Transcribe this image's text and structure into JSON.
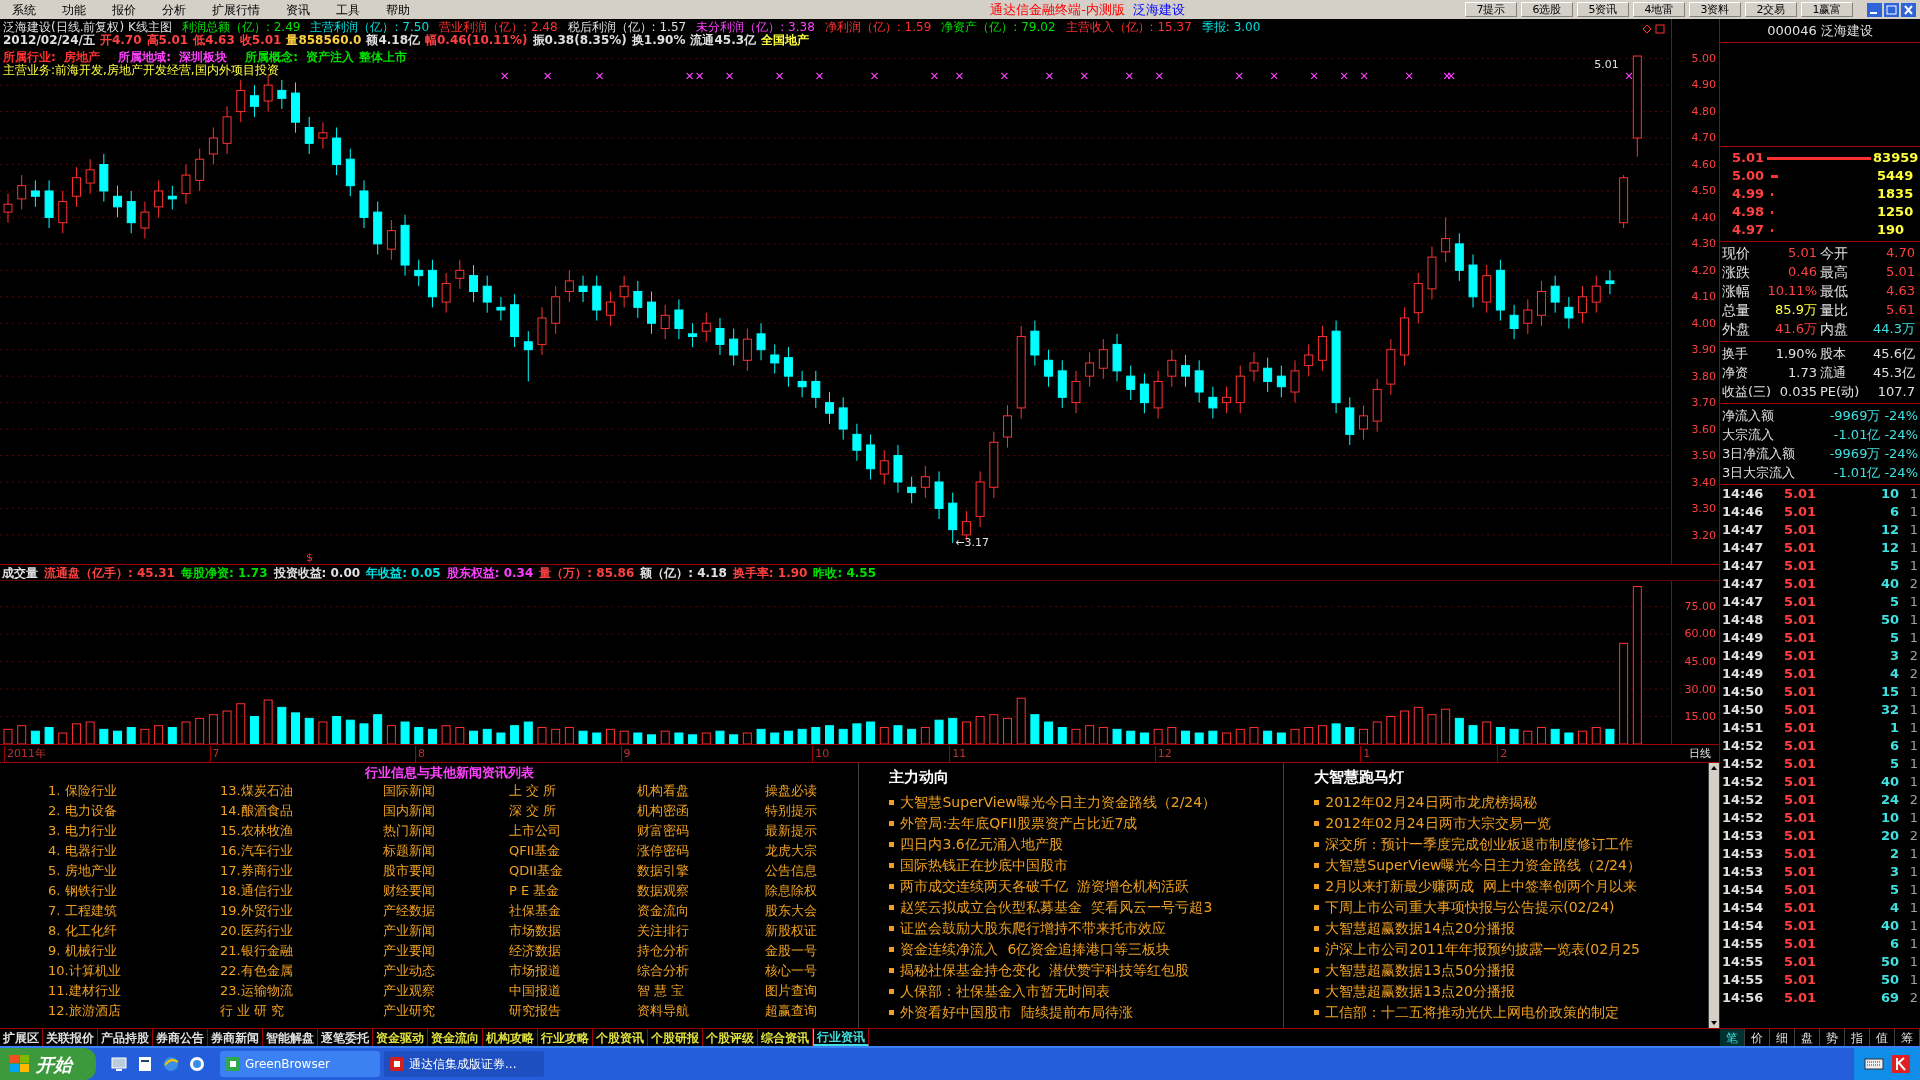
{
  "menu": [
    "系统",
    "功能",
    "报价",
    "分析",
    "扩展行情",
    "资讯",
    "工具",
    "帮助"
  ],
  "title_bar": {
    "app_title": "通达信金融终端-内测版",
    "stock_name": "泛海建设",
    "buttons": [
      "7提示",
      "6选股",
      "5资讯",
      "4地雷",
      "3资料",
      "2交易",
      "1赢富"
    ]
  },
  "chart": {
    "header_title": "泛海建设(日线.前复权) K线主图",
    "finance": [
      {
        "text": "利润总额（亿）: 2.49",
        "color": "#00e000"
      },
      {
        "text": "主营利润（亿）: 7.50",
        "color": "#00e0e0"
      },
      {
        "text": "营业利润（亿）: 2.48",
        "color": "#ff3030"
      },
      {
        "text": "税后利润（亿）: 1.57",
        "color": "#e0e0e0"
      },
      {
        "text": "未分利润（亿）: 3.38",
        "color": "#ff40ff"
      },
      {
        "text": "净利润（亿）: 1.59",
        "color": "#ff3030"
      },
      {
        "text": "净资产（亿）: 79.02",
        "color": "#00e000"
      },
      {
        "text": "主营收入（亿）: 15.37",
        "color": "#ff3030"
      },
      {
        "text": "季报: 3.00",
        "color": "#00e0e0"
      }
    ],
    "quote_line": [
      {
        "text": "2012/02/24/五",
        "color": "#e0e0e0"
      },
      {
        "text": "开4.70",
        "color": "#ff4040"
      },
      {
        "text": "高5.01",
        "color": "#ff4040"
      },
      {
        "text": "低4.63",
        "color": "#ff4040"
      },
      {
        "text": "收5.01",
        "color": "#ff4040"
      },
      {
        "text": "量858560.0",
        "color": "#ffd040"
      },
      {
        "text": "额4.18亿",
        "color": "#e0e0e0"
      },
      {
        "text": "幅0.46(10.11%)",
        "color": "#ff4040"
      },
      {
        "text": "振0.38(8.35%)",
        "color": "#e0e0e0"
      },
      {
        "text": "换1.90%",
        "color": "#e0e0e0"
      },
      {
        "text": "流通45.3亿",
        "color": "#e0e0e0"
      },
      {
        "text": "全国地产",
        "color": "#ffff40"
      }
    ],
    "tags": [
      {
        "label": "所属行业:",
        "value": "房地产",
        "color": "#ff3030"
      },
      {
        "label": "所属地域:",
        "value": "深圳板块",
        "color": "#ff40ff"
      },
      {
        "label": "所属概念:",
        "value": "资产注入 整体上市",
        "color": "#00e000"
      }
    ],
    "business": "主营业务:前海开发,房地产开发经营,国内外项目投资",
    "high_label": "5.01",
    "low_label": "←3.17",
    "chart_data": {
      "type": "candlestick",
      "grid": true,
      "ylim": [
        3.09,
        5.15
      ],
      "yticks": [
        {
          "value": 5,
          "label": "5.00"
        },
        {
          "value": 4.9,
          "label": "4.90"
        },
        {
          "value": 4.8,
          "label": "4.80"
        },
        {
          "value": 4.7,
          "label": "4.70"
        },
        {
          "value": 4.6,
          "label": "4.60"
        },
        {
          "value": 4.5,
          "label": "4.50"
        },
        {
          "value": 4.4,
          "label": "4.40"
        },
        {
          "value": 4.3,
          "label": "4.30"
        },
        {
          "value": 4.2,
          "label": "4.20"
        },
        {
          "value": 4.1,
          "label": "4.10"
        },
        {
          "value": 4,
          "label": "4.00"
        },
        {
          "value": 3.9,
          "label": "3.90"
        },
        {
          "value": 3.8,
          "label": "3.80"
        },
        {
          "value": 3.7,
          "label": "3.70"
        },
        {
          "value": 3.6,
          "label": "3.60"
        },
        {
          "value": 3.5,
          "label": "3.50"
        },
        {
          "value": 3.4,
          "label": "3.40"
        },
        {
          "value": 3.3,
          "label": "3.30"
        },
        {
          "value": 3.2,
          "label": "3.20"
        }
      ],
      "ohlc": [
        [
          4.42,
          4.49,
          4.38,
          4.45
        ],
        [
          4.47,
          4.56,
          4.43,
          4.52
        ],
        [
          4.5,
          4.54,
          4.44,
          4.48
        ],
        [
          4.5,
          4.54,
          4.36,
          4.4
        ],
        [
          4.38,
          4.5,
          4.34,
          4.46
        ],
        [
          4.48,
          4.59,
          4.44,
          4.55
        ],
        [
          4.53,
          4.62,
          4.49,
          4.58
        ],
        [
          4.6,
          4.64,
          4.46,
          4.5
        ],
        [
          4.48,
          4.52,
          4.4,
          4.44
        ],
        [
          4.46,
          4.5,
          4.34,
          4.38
        ],
        [
          4.36,
          4.46,
          4.32,
          4.42
        ],
        [
          4.44,
          4.54,
          4.4,
          4.5
        ],
        [
          4.48,
          4.52,
          4.43,
          4.47
        ],
        [
          4.49,
          4.6,
          4.45,
          4.56
        ],
        [
          4.54,
          4.66,
          4.5,
          4.62
        ],
        [
          4.64,
          4.74,
          4.6,
          4.7
        ],
        [
          4.68,
          4.82,
          4.64,
          4.78
        ],
        [
          4.8,
          4.92,
          4.76,
          4.88
        ],
        [
          4.86,
          4.9,
          4.78,
          4.82
        ],
        [
          4.84,
          4.94,
          4.8,
          4.9
        ],
        [
          4.88,
          4.92,
          4.81,
          4.85
        ],
        [
          4.87,
          4.91,
          4.72,
          4.76
        ],
        [
          4.74,
          4.78,
          4.64,
          4.68
        ],
        [
          4.7,
          4.76,
          4.66,
          4.72
        ],
        [
          4.7,
          4.74,
          4.56,
          4.6
        ],
        [
          4.62,
          4.66,
          4.48,
          4.52
        ],
        [
          4.5,
          4.54,
          4.36,
          4.4
        ],
        [
          4.42,
          4.46,
          4.26,
          4.3
        ],
        [
          4.28,
          4.39,
          4.24,
          4.35
        ],
        [
          4.37,
          4.41,
          4.18,
          4.22
        ],
        [
          4.2,
          4.24,
          4.14,
          4.18
        ],
        [
          4.2,
          4.24,
          4.06,
          4.1
        ],
        [
          4.08,
          4.19,
          4.04,
          4.15
        ],
        [
          4.17,
          4.24,
          4.13,
          4.2
        ],
        [
          4.18,
          4.22,
          4.08,
          4.12
        ],
        [
          4.14,
          4.18,
          4.04,
          4.08
        ],
        [
          4.06,
          4.1,
          4.01,
          4.05
        ],
        [
          4.07,
          4.11,
          3.91,
          3.95
        ],
        [
          3.93,
          3.97,
          3.78,
          3.9
        ],
        [
          3.92,
          4.06,
          3.88,
          4.02
        ],
        [
          4.0,
          4.14,
          3.96,
          4.1
        ],
        [
          4.12,
          4.2,
          4.08,
          4.16
        ],
        [
          4.14,
          4.18,
          4.08,
          4.12
        ],
        [
          4.14,
          4.18,
          4.01,
          4.05
        ],
        [
          4.03,
          4.12,
          3.99,
          4.08
        ],
        [
          4.1,
          4.18,
          4.06,
          4.14
        ],
        [
          4.12,
          4.16,
          4.02,
          4.06
        ],
        [
          4.08,
          4.12,
          3.96,
          4.0
        ],
        [
          3.98,
          4.07,
          3.94,
          4.03
        ],
        [
          4.05,
          4.09,
          3.94,
          3.98
        ],
        [
          3.96,
          4.0,
          3.91,
          3.95
        ],
        [
          3.97,
          4.04,
          3.93,
          4.0
        ],
        [
          3.98,
          4.02,
          3.88,
          3.92
        ],
        [
          3.94,
          3.98,
          3.84,
          3.88
        ],
        [
          3.86,
          3.98,
          3.82,
          3.94
        ],
        [
          3.96,
          4.0,
          3.86,
          3.9
        ],
        [
          3.88,
          3.92,
          3.81,
          3.85
        ],
        [
          3.87,
          3.91,
          3.76,
          3.8
        ],
        [
          3.78,
          3.82,
          3.72,
          3.76
        ],
        [
          3.78,
          3.82,
          3.68,
          3.72
        ],
        [
          3.7,
          3.74,
          3.62,
          3.66
        ],
        [
          3.68,
          3.72,
          3.56,
          3.6
        ],
        [
          3.58,
          3.62,
          3.48,
          3.52
        ],
        [
          3.54,
          3.58,
          3.41,
          3.45
        ],
        [
          3.43,
          3.52,
          3.39,
          3.48
        ],
        [
          3.5,
          3.54,
          3.36,
          3.4
        ],
        [
          3.38,
          3.42,
          3.32,
          3.36
        ],
        [
          3.38,
          3.46,
          3.34,
          3.42
        ],
        [
          3.4,
          3.44,
          3.26,
          3.3
        ],
        [
          3.32,
          3.36,
          3.17,
          3.22
        ],
        [
          3.2,
          3.29,
          3.18,
          3.25
        ],
        [
          3.27,
          3.44,
          3.23,
          3.4
        ],
        [
          3.38,
          3.59,
          3.34,
          3.55
        ],
        [
          3.57,
          3.69,
          3.53,
          3.65
        ],
        [
          3.68,
          3.99,
          3.64,
          3.95
        ],
        [
          3.97,
          4.01,
          3.84,
          3.88
        ],
        [
          3.86,
          3.9,
          3.76,
          3.8
        ],
        [
          3.82,
          3.86,
          3.68,
          3.72
        ],
        [
          3.7,
          3.82,
          3.66,
          3.78
        ],
        [
          3.8,
          3.89,
          3.76,
          3.85
        ],
        [
          3.83,
          3.94,
          3.79,
          3.9
        ],
        [
          3.92,
          3.96,
          3.78,
          3.82
        ],
        [
          3.8,
          3.84,
          3.71,
          3.75
        ],
        [
          3.77,
          3.81,
          3.66,
          3.7
        ],
        [
          3.68,
          3.82,
          3.64,
          3.78
        ],
        [
          3.8,
          3.9,
          3.76,
          3.86
        ],
        [
          3.84,
          3.88,
          3.76,
          3.8
        ],
        [
          3.82,
          3.86,
          3.7,
          3.74
        ],
        [
          3.72,
          3.76,
          3.64,
          3.68
        ],
        [
          3.7,
          3.76,
          3.66,
          3.72
        ],
        [
          3.7,
          3.84,
          3.66,
          3.8
        ],
        [
          3.82,
          3.89,
          3.78,
          3.85
        ],
        [
          3.83,
          3.87,
          3.74,
          3.78
        ],
        [
          3.8,
          3.84,
          3.72,
          3.76
        ],
        [
          3.74,
          3.86,
          3.7,
          3.82
        ],
        [
          3.84,
          3.92,
          3.8,
          3.88
        ],
        [
          3.86,
          3.99,
          3.82,
          3.95
        ],
        [
          3.97,
          4.01,
          3.66,
          3.7
        ],
        [
          3.68,
          3.72,
          3.54,
          3.58
        ],
        [
          3.6,
          3.69,
          3.56,
          3.65
        ],
        [
          3.63,
          3.79,
          3.59,
          3.75
        ],
        [
          3.77,
          3.94,
          3.73,
          3.9
        ],
        [
          3.88,
          4.06,
          3.84,
          4.02
        ],
        [
          4.04,
          4.19,
          4.0,
          4.15
        ],
        [
          4.13,
          4.29,
          4.09,
          4.25
        ],
        [
          4.27,
          4.4,
          4.23,
          4.32
        ],
        [
          4.3,
          4.34,
          4.16,
          4.2
        ],
        [
          4.22,
          4.26,
          4.06,
          4.1
        ],
        [
          4.08,
          4.22,
          4.04,
          4.18
        ],
        [
          4.2,
          4.24,
          4.01,
          4.05
        ],
        [
          4.03,
          4.07,
          3.94,
          3.98
        ],
        [
          4.0,
          4.09,
          3.96,
          4.05
        ],
        [
          4.03,
          4.16,
          3.99,
          4.12
        ],
        [
          4.14,
          4.18,
          4.04,
          4.08
        ],
        [
          4.06,
          4.1,
          3.98,
          4.02
        ],
        [
          4.04,
          4.14,
          4.0,
          4.1
        ],
        [
          4.08,
          4.18,
          4.04,
          4.14
        ],
        [
          4.16,
          4.2,
          4.11,
          4.15
        ],
        [
          4.38,
          4.56,
          4.36,
          4.55
        ],
        [
          4.7,
          5.01,
          4.63,
          5.01
        ]
      ]
    }
  },
  "volume": {
    "header": [
      {
        "text": "成交量",
        "color": "#e0e0e0"
      },
      {
        "text": "流通盘（亿手）: 45.31",
        "color": "#ff4040"
      },
      {
        "text": "每股净资: 1.73",
        "color": "#00e000"
      },
      {
        "text": "投资收益: 0.00",
        "color": "#e0e0e0"
      },
      {
        "text": "年收益: 0.05",
        "color": "#00e0e0"
      },
      {
        "text": "股东权益: 0.34",
        "color": "#ff40ff"
      },
      {
        "text": "量（万）: 85.86",
        "color": "#ff4040"
      },
      {
        "text": "额（亿）: 4.18",
        "color": "#e0e0e0"
      },
      {
        "text": "换手率: 1.90",
        "color": "#ff4040"
      },
      {
        "text": "昨收: 4.55",
        "color": "#00e000"
      }
    ],
    "marker": "$",
    "chart_data": {
      "type": "bar",
      "grid": true,
      "ylim": [
        0,
        89
      ],
      "yticks": [
        {
          "value": 75,
          "label": "75.00"
        },
        {
          "value": 60,
          "label": "60.00"
        },
        {
          "value": 45,
          "label": "45.00"
        },
        {
          "value": 30,
          "label": "30.00"
        },
        {
          "value": 15,
          "label": "15.00"
        }
      ],
      "values": [
        8,
        10,
        7,
        9,
        6,
        11,
        12,
        8,
        7,
        9,
        8,
        10,
        9,
        12,
        14,
        16,
        18,
        22,
        15,
        24,
        20,
        17,
        14,
        12,
        15,
        13,
        11,
        16,
        10,
        12,
        9,
        8,
        10,
        9,
        7,
        8,
        6,
        10,
        12,
        9,
        8,
        9,
        7,
        6,
        8,
        7,
        6,
        5,
        7,
        6,
        5,
        6,
        7,
        5,
        6,
        8,
        6,
        7,
        8,
        9,
        10,
        8,
        11,
        12,
        9,
        10,
        8,
        9,
        13,
        14,
        12,
        15,
        16,
        14,
        25,
        16,
        12,
        9,
        8,
        10,
        9,
        8,
        7,
        6,
        8,
        9,
        7,
        6,
        7,
        6,
        8,
        9,
        7,
        6,
        8,
        9,
        10,
        11,
        9,
        8,
        12,
        15,
        18,
        20,
        16,
        19,
        14,
        10,
        12,
        9,
        8,
        7,
        9,
        8,
        6,
        7,
        9,
        8,
        55,
        86
      ]
    }
  },
  "time_axis": {
    "labels": [
      "2011年",
      "7",
      "8",
      "9",
      "10",
      "11",
      "12",
      "1",
      "2"
    ],
    "period": "日线"
  },
  "industry_list": {
    "title": "行业信息与其他新闻资讯列表",
    "columns": [
      [
        "1. 保险行业",
        "2. 电力设备",
        "3. 电力行业",
        "4. 电器行业",
        "5. 房地产业",
        "6. 钢铁行业",
        "7. 工程建筑",
        "8. 化工化纤",
        "9. 机械行业",
        "10.计算机业",
        "11.建材行业",
        "12.旅游酒店"
      ],
      [
        "13.煤炭石油",
        "14.酿酒食品",
        "15.农林牧渔",
        "16.汽车行业",
        "17.券商行业",
        "18.通信行业",
        "19.外贸行业",
        "20.医药行业",
        "21.银行金融",
        "22.有色金属",
        "23.运输物流",
        "行 业 研 究"
      ],
      [
        "国际新闻",
        "国内新闻",
        "热门新闻",
        "标题新闻",
        "股市要闻",
        "财经要闻",
        "产经数据",
        "产业新闻",
        "产业要闻",
        "产业动态",
        "产业观察",
        "产业研究"
      ],
      [
        "上 交 所",
        "深 交 所",
        "上市公司",
        "QFII基金",
        "QDII基金",
        "P E 基金",
        "社保基金",
        "市场数据",
        "经济数据",
        "市场报道",
        "中国报道",
        "研究报告"
      ],
      [
        "机构看盘",
        "机构密函",
        "财富密码",
        "涨停密码",
        "数据引擎",
        "数据观察",
        "资金流向",
        "关注排行",
        "持仓分析",
        "综合分析",
        "智 慧 宝",
        "资料导航"
      ],
      [
        "操盘必读",
        "特别提示",
        "最新提示",
        "龙虎大宗",
        "公告信息",
        "除息除权",
        "股东大会",
        "新股权证",
        "金股一号",
        "核心一号",
        "图片查询",
        "超赢查询"
      ]
    ]
  },
  "news": [
    {
      "title": "主力动向",
      "items": [
        "大智慧SuperView曝光今日主力资金路线（2/24）",
        "外管局:去年底QFII股票资产占比近7成",
        "四日内3.6亿元涌入地产股",
        "国际热钱正在抄底中国股市",
        "两市成交连续两天各破千亿  游资增仓机构活跃",
        "赵笑云拟成立合伙型私募基金  笑看风云一号亏超3",
        "证监会鼓励大股东爬行增持不带来托市效应",
        "资金连续净流入  6亿资金追捧港口等三板块",
        "揭秘社保基金持仓变化  潜伏赞宇科技等红包股",
        "人保部：社保基金入市暂无时间表",
        "外资看好中国股市  陆续提前布局待涨"
      ]
    },
    {
      "title": "大智慧跑马灯",
      "items": [
        "2012年02月24日两市龙虎榜揭秘",
        "2012年02月24日两市大宗交易一览",
        "深交所：预计一季度完成创业板退市制度修订工作",
        "大智慧SuperView曝光今日主力资金路线（2/24）",
        "2月以来打新最少赚两成  网上中签率创两个月以来",
        "下周上市公司重大事项快报与公告提示(02/24)",
        "大智慧超赢数据14点20分播报",
        "沪深上市公司2011年年报预约披露一览表(02月25",
        "大智慧超赢数据13点50分播报",
        "大智慧超赢数据13点20分播报",
        "工信部：十二五将推动光伏上网电价政策的制定"
      ]
    }
  ],
  "bottom_tabs": [
    {
      "label": "扩展区",
      "selected": false,
      "color": "#e0e0e0"
    },
    {
      "label": "关联报价",
      "selected": false,
      "color": "#e0e0e0"
    },
    {
      "label": "产品持股",
      "selected": false,
      "color": "#e0e0e0"
    },
    {
      "label": "券商公告",
      "selected": false,
      "color": "#e0e0e0"
    },
    {
      "label": "券商新闻",
      "selected": false,
      "color": "#e0e0e0"
    },
    {
      "label": "智能解盘",
      "selected": false,
      "color": "#e0e0e0"
    },
    {
      "label": "逐笔委托",
      "selected": false,
      "color": "#e0e0e0"
    },
    {
      "label": "资金驱动",
      "selected": false,
      "color": "#e0e040"
    },
    {
      "label": "资金流向",
      "selected": false,
      "color": "#e0e040"
    },
    {
      "label": "机构攻略",
      "selected": false,
      "color": "#e0e040"
    },
    {
      "label": "行业攻略",
      "selected": false,
      "color": "#e0e040"
    },
    {
      "label": "个股资讯",
      "selected": false,
      "color": "#e0e040"
    },
    {
      "label": "个股研报",
      "selected": false,
      "color": "#e0e040"
    },
    {
      "label": "个股评级",
      "selected": false,
      "color": "#e0e040"
    },
    {
      "label": "综合资讯",
      "selected": false,
      "color": "#e0e040"
    },
    {
      "label": "行业资讯",
      "selected": true,
      "color": "#40e0e0"
    }
  ],
  "side": {
    "code": "000046",
    "name": "泛海建设",
    "order_book": [
      {
        "price": "5.01",
        "volume": "83959"
      },
      {
        "price": "5.00",
        "volume": "5449"
      },
      {
        "price": "4.99",
        "volume": "1835"
      },
      {
        "price": "4.98",
        "volume": "1250"
      },
      {
        "price": "4.97",
        "volume": "190"
      }
    ],
    "quote": [
      [
        {
          "label": "现价",
          "value": "5.01",
          "color": "#ff4040"
        },
        {
          "label": "今开",
          "value": "4.70",
          "color": "#ff4040"
        }
      ],
      [
        {
          "label": "涨跌",
          "value": "0.46",
          "color": "#ff4040"
        },
        {
          "label": "最高",
          "value": "5.01",
          "color": "#ff4040"
        }
      ],
      [
        {
          "label": "涨幅",
          "value": "10.11%",
          "color": "#ff4040"
        },
        {
          "label": "最低",
          "value": "4.63",
          "color": "#ff4040"
        }
      ],
      [
        {
          "label": "总量",
          "value": "85.9万",
          "color": "#ffff40"
        },
        {
          "label": "量比",
          "value": "5.61",
          "color": "#ff4040"
        }
      ],
      [
        {
          "label": "外盘",
          "value": "41.6万",
          "color": "#ff4040"
        },
        {
          "label": "内盘",
          "value": "44.3万",
          "color": "#40e0e0"
        }
      ]
    ],
    "fundamentals": [
      [
        {
          "label": "换手",
          "value": "1.90%"
        },
        {
          "label": "股本",
          "value": "45.6亿"
        }
      ],
      [
        {
          "label": "净资",
          "value": "1.73"
        },
        {
          "label": "流通",
          "value": "45.3亿"
        }
      ],
      [
        {
          "label": "收益(三)",
          "value": "0.035"
        },
        {
          "label": "PE(动)",
          "value": "107.7"
        }
      ]
    ],
    "fund_flow": [
      {
        "label": "净流入额",
        "value": "-9969万",
        "pct": "-24%"
      },
      {
        "label": "大宗流入",
        "value": "-1.01亿",
        "pct": "-24%"
      },
      {
        "label": "3日净流入额",
        "value": "-9969万",
        "pct": "-24%"
      },
      {
        "label": "3日大宗流入",
        "value": "-1.01亿",
        "pct": "-24%"
      }
    ],
    "ticks": [
      [
        "14:46",
        "5.01",
        "10",
        "1"
      ],
      [
        "14:46",
        "5.01",
        "6",
        "1"
      ],
      [
        "14:47",
        "5.01",
        "12",
        "1"
      ],
      [
        "14:47",
        "5.01",
        "12",
        "1"
      ],
      [
        "14:47",
        "5.01",
        "5",
        "1"
      ],
      [
        "14:47",
        "5.01",
        "40",
        "2"
      ],
      [
        "14:47",
        "5.01",
        "5",
        "1"
      ],
      [
        "14:48",
        "5.01",
        "50",
        "1"
      ],
      [
        "14:49",
        "5.01",
        "5",
        "1"
      ],
      [
        "14:49",
        "5.01",
        "3",
        "2"
      ],
      [
        "14:49",
        "5.01",
        "4",
        "2"
      ],
      [
        "14:50",
        "5.01",
        "15",
        "1"
      ],
      [
        "14:50",
        "5.01",
        "32",
        "1"
      ],
      [
        "14:51",
        "5.01",
        "1",
        "1"
      ],
      [
        "14:52",
        "5.01",
        "6",
        "1"
      ],
      [
        "14:52",
        "5.01",
        "5",
        "1"
      ],
      [
        "14:52",
        "5.01",
        "40",
        "1"
      ],
      [
        "14:52",
        "5.01",
        "24",
        "2"
      ],
      [
        "14:52",
        "5.01",
        "10",
        "1"
      ],
      [
        "14:53",
        "5.01",
        "20",
        "2"
      ],
      [
        "14:53",
        "5.01",
        "2",
        "1"
      ],
      [
        "14:53",
        "5.01",
        "3",
        "1"
      ],
      [
        "14:54",
        "5.01",
        "5",
        "1"
      ],
      [
        "14:54",
        "5.01",
        "4",
        "1"
      ],
      [
        "14:54",
        "5.01",
        "40",
        "1"
      ],
      [
        "14:55",
        "5.01",
        "6",
        "1"
      ],
      [
        "14:55",
        "5.01",
        "50",
        "1"
      ],
      [
        "14:55",
        "5.01",
        "50",
        "1"
      ],
      [
        "14:56",
        "5.01",
        "69",
        "2"
      ]
    ],
    "tabs": [
      {
        "label": "笔",
        "selected": true
      },
      {
        "label": "价",
        "selected": false
      },
      {
        "label": "细",
        "selected": false
      },
      {
        "label": "盘",
        "selected": false
      },
      {
        "label": "势",
        "selected": false
      },
      {
        "label": "指",
        "selected": false
      },
      {
        "label": "值",
        "selected": false
      },
      {
        "label": "筹",
        "selected": false
      }
    ]
  },
  "taskbar": {
    "start": "开始",
    "tasks": [
      {
        "label": "GreenBrowser",
        "selected": false
      },
      {
        "label": "通达信集成版证券...",
        "selected": true
      }
    ]
  }
}
